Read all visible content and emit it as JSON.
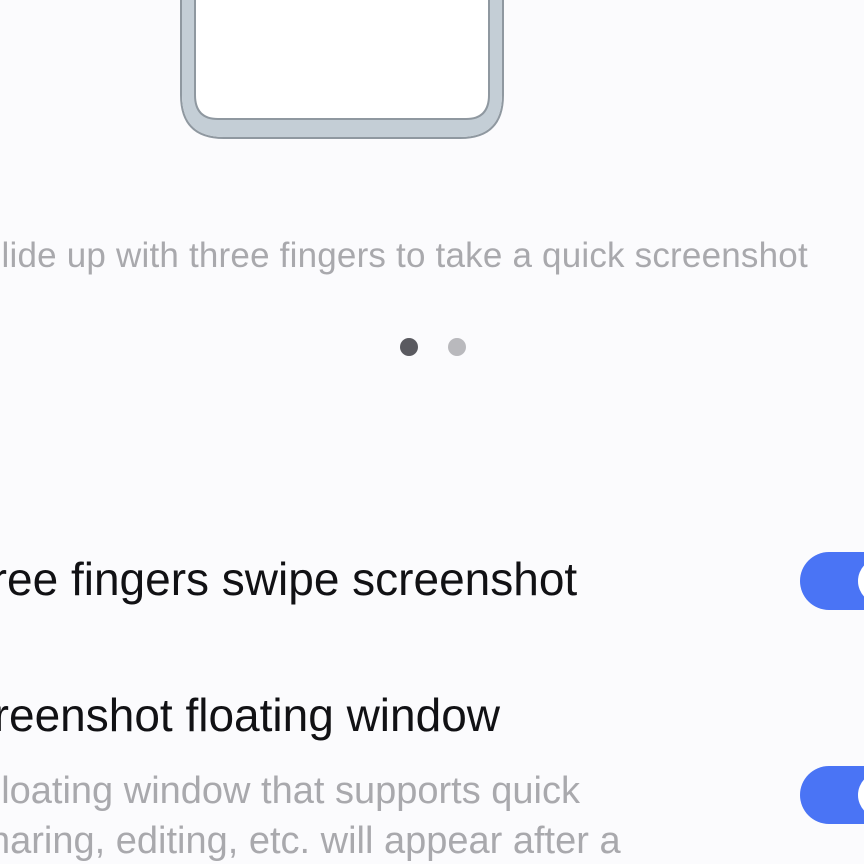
{
  "illustration": {
    "icon": "phone-outline-illustration",
    "frame_color": "#c4ced6"
  },
  "caption": "Slide up with three fingers to take a quick screenshot",
  "pager": {
    "total_pages": 2,
    "active_page": 1
  },
  "settings": [
    {
      "title": "Three fingers swipe screenshot",
      "enabled": true
    },
    {
      "title": "Screenshot floating window",
      "description_lines": [
        "Floating window that supports quick",
        "sharing, editing, etc. will appear after a"
      ],
      "enabled": true
    }
  ],
  "colors": {
    "accent": "#4a74f5",
    "background": "#fbfbfd",
    "title_text": "#111114",
    "secondary_text": "#a9a9ad"
  }
}
